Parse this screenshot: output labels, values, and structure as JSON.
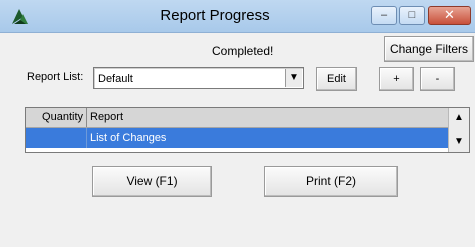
{
  "window": {
    "title": "Report Progress",
    "minimize_glyph": "–",
    "maximize_glyph": "□",
    "close_glyph": "✕"
  },
  "status_text": "Completed!",
  "toolbar": {
    "change_filters_label": "Change Filters",
    "report_list_label": "Report List:",
    "report_list_value": "Default",
    "dropdown_glyph": "▼",
    "edit_label": "Edit",
    "add_label": "+",
    "remove_label": "-"
  },
  "grid": {
    "columns": [
      "Quantity",
      "Report"
    ],
    "rows": [
      {
        "quantity": "",
        "report": "List of Changes",
        "selected": true
      }
    ],
    "scroll_up_glyph": "▲",
    "scroll_down_glyph": "▼"
  },
  "actions": {
    "view_label": "View (F1)",
    "print_label": "Print (F2)"
  },
  "colors": {
    "titlebar": "#b6d1ee",
    "selection": "#3a7bdc",
    "close_button": "#c8503a"
  },
  "icons": {
    "app": "app-logo-icon"
  }
}
